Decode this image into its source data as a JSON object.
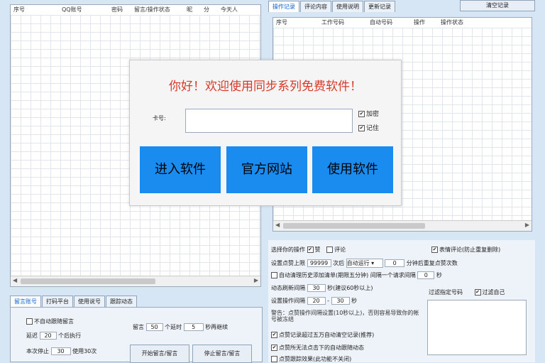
{
  "left_grid": {
    "columns": [
      "序号",
      "QQ账号",
      "密码",
      "留言/操作状态",
      "昵",
      "分",
      "今天人"
    ]
  },
  "right_top": {
    "tabs": [
      "操作记录",
      "评论内容",
      "使用说明",
      "更新记录"
    ],
    "clear_button": "清空记录",
    "columns": [
      "序号",
      "工作号码",
      "自动号码",
      "操作",
      "操作状态"
    ]
  },
  "left_bottom": {
    "tabs": [
      "留言账号",
      "打码平台",
      "使用说号",
      "跟踪动态"
    ],
    "auto_label": "不自动跟随留言",
    "delay_label": "延迟",
    "delay_value": "20",
    "delay_unit": "个后执行",
    "stop_label": "本次停止",
    "stop_value": "30",
    "stop_unit": "使用30次",
    "count_label": "留言",
    "count_value": "50",
    "count_unit": "个延时",
    "sec_value": "5",
    "sec_unit": "秒再继续",
    "btn_start": "开始留言/留言",
    "btn_stop": "停止留言/留言"
  },
  "right_bottom": {
    "select_label": "选择你的操作",
    "opt1": "赞",
    "opt2": "评论",
    "opt3": "表情评论(防止重复删除)",
    "setlimit_label": "设置点赞上限",
    "limit_value": "99999",
    "limit_unit": "次后",
    "autorun": "自动运行",
    "min_value": "0",
    "min_unit": "分钟后重复点赞次数",
    "auto_clear": "自动清理历史添加清单(期限五分钟)",
    "interval_label": "间隔一个请求间隔",
    "interval_value": "0",
    "interval_unit": "秒",
    "refresh_label": "动态刷新间隔",
    "refresh_value": "30",
    "refresh_unit": "秒(建议60秒以上)",
    "op_interval_label": "设置操作间隔",
    "op_from": "20",
    "op_to": "30",
    "op_unit": "秒",
    "hint": "警告：点赞操作间隔设置(10秒以上)，否则容易导致你的帐号被冻结",
    "filter_label": "过滤指定号码",
    "filter_self": "过滤自己",
    "check1": "点赞记录超过五万自动清空记录(推荐)",
    "check2": "点赞所无法点击下的自动跟随动态",
    "check3": "点赞跟踪效果(此功能不关闭)"
  },
  "dialog": {
    "greeting": "你好！欢迎使用同步系列免费软件！",
    "card_label": "卡号:",
    "card_value": "",
    "check_encrypt": "加密",
    "check_remember": "记住",
    "btn_enter": "进入软件",
    "btn_site": "官方网站",
    "btn_use": "使用软件"
  },
  "colors": {
    "accent": "#1a8cf0",
    "greeting": "#d83a2a",
    "background": "#d7e6f5"
  }
}
